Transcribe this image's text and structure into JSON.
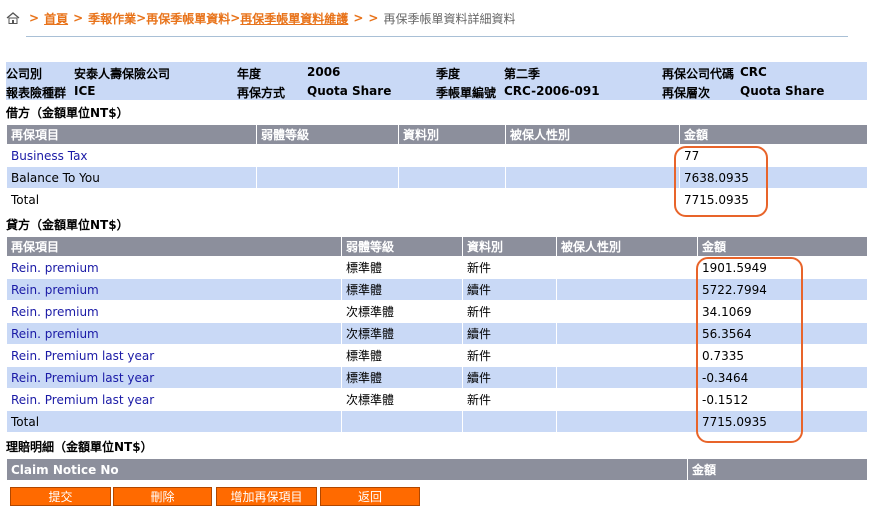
{
  "breadcrumb": {
    "items": [
      "首頁",
      "季報作業",
      "再保季帳單資料",
      "再保季帳單資料維護"
    ],
    "current": "再保季帳單資料詳細資料"
  },
  "info": {
    "company_label": "公司別",
    "company_value": "安泰人壽保險公司",
    "year_label": "年度",
    "year_value": "2006",
    "quarter_label": "季度",
    "quarter_value": "第二季",
    "reins_code_label": "再保公司代碼",
    "reins_code_value": "CRC",
    "type_label": "報表險種群",
    "type_value": "ICE",
    "method_label": "再保方式",
    "method_value": "Quota Share",
    "bill_no_label": "季帳單編號",
    "bill_no_value": "CRC-2006-091",
    "layer_label": "再保層次",
    "layer_value": "Quota Share"
  },
  "debit": {
    "title": "借方（金額單位NT$）",
    "headers": [
      "再保項目",
      "弱體等級",
      "資料別",
      "被保人性別",
      "金額"
    ],
    "rows": [
      {
        "item": "Business Tax",
        "grade": "",
        "kind": "",
        "sex": "",
        "amount": "77",
        "link": true
      },
      {
        "item": "Balance To You",
        "grade": "",
        "kind": "",
        "sex": "",
        "amount": "7638.0935",
        "link": false
      },
      {
        "item": "Total",
        "grade": "",
        "kind": "",
        "sex": "",
        "amount": "7715.0935",
        "link": false
      }
    ]
  },
  "credit": {
    "title": "貸方（金額單位NT$）",
    "headers": [
      "再保項目",
      "弱體等級",
      "資料別",
      "被保人性別",
      "金額"
    ],
    "rows": [
      {
        "item": "Rein. premium",
        "grade": "標準體",
        "kind": "新件",
        "sex": "",
        "amount": "1901.5949",
        "link": true
      },
      {
        "item": "Rein. premium",
        "grade": "標準體",
        "kind": "續件",
        "sex": "",
        "amount": "5722.7994",
        "link": true
      },
      {
        "item": "Rein. premium",
        "grade": "次標準體",
        "kind": "新件",
        "sex": "",
        "amount": "34.1069",
        "link": true
      },
      {
        "item": "Rein. premium",
        "grade": "次標準體",
        "kind": "續件",
        "sex": "",
        "amount": "56.3564",
        "link": true
      },
      {
        "item": "Rein. Premium last year",
        "grade": "標準體",
        "kind": "新件",
        "sex": "",
        "amount": "0.7335",
        "link": true
      },
      {
        "item": "Rein. Premium last year",
        "grade": "標準體",
        "kind": "續件",
        "sex": "",
        "amount": "-0.3464",
        "link": true
      },
      {
        "item": "Rein. Premium last year",
        "grade": "次標準體",
        "kind": "新件",
        "sex": "",
        "amount": "-0.1512",
        "link": true
      },
      {
        "item": "Total",
        "grade": "",
        "kind": "",
        "sex": "",
        "amount": "7715.0935",
        "link": false
      }
    ]
  },
  "claims": {
    "title": "理賠明細（金額單位NT$）",
    "headers": [
      "Claim Notice No",
      "金額"
    ]
  },
  "buttons": {
    "submit": "提交",
    "delete": "刪除",
    "add_item": "增加再保項目",
    "back": "返回"
  },
  "colors": {
    "accent": "#e8731a",
    "header_bg": "#8c8f9c",
    "row_blue": "#c9d9f6",
    "button_bg": "#ff6a00",
    "highlight_oval": "#e8642a",
    "link": "#1a1aa6"
  }
}
